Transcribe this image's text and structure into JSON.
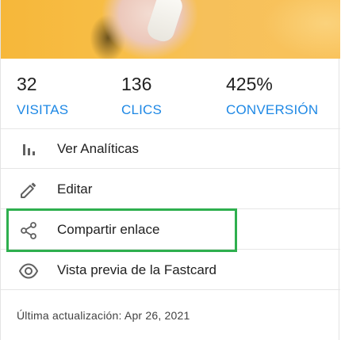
{
  "stats": [
    {
      "value": "32",
      "label": "VISITAS"
    },
    {
      "value": "136",
      "label": "CLICS"
    },
    {
      "value": "425%",
      "label": "CONVERSIÓN"
    }
  ],
  "menu": [
    {
      "label": "Ver Analíticas",
      "icon": "bar-chart-icon"
    },
    {
      "label": "Editar",
      "icon": "pencil-icon"
    },
    {
      "label": "Compartir enlace",
      "icon": "share-icon"
    },
    {
      "label": "Vista previa de la Fastcard",
      "icon": "eye-icon"
    }
  ],
  "footer": {
    "text": "Última actualización: Apr 26, 2021"
  },
  "colors": {
    "accent": "#1e88e5",
    "highlight": "#2eaf4e",
    "banner": "#f8c04a"
  }
}
